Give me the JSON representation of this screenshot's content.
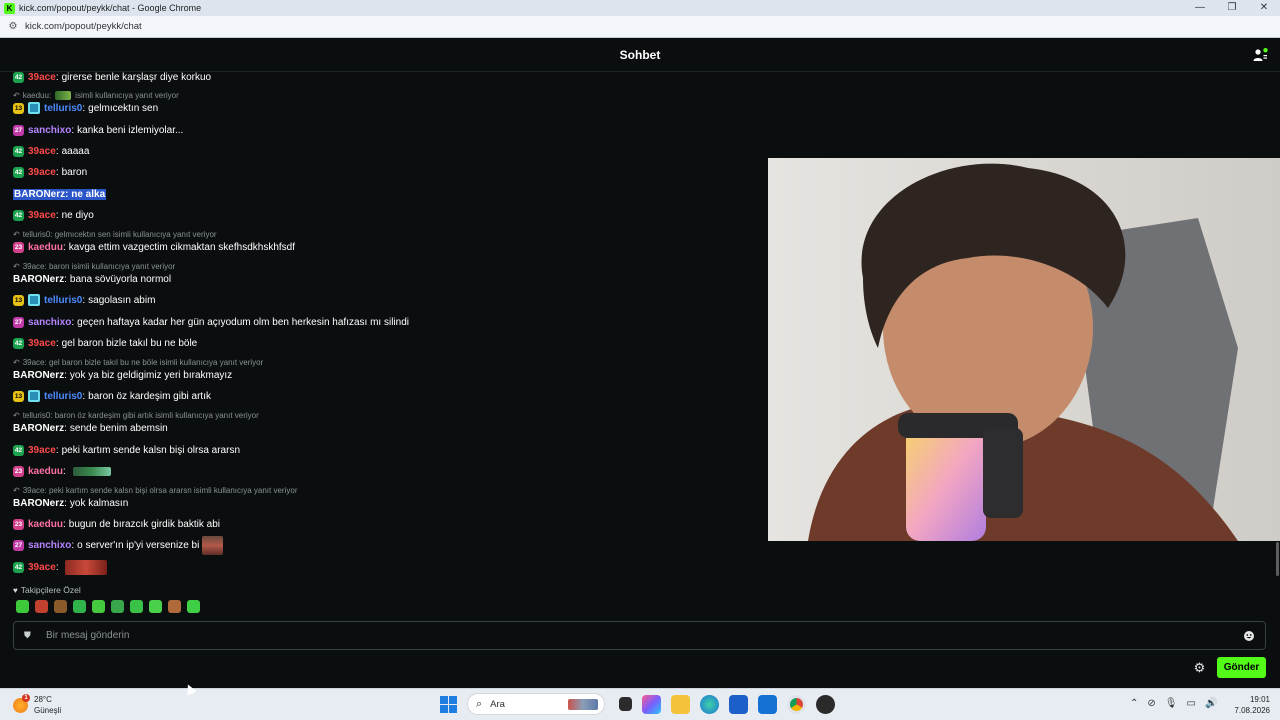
{
  "window": {
    "title": "kick.com/popout/peykk/chat - Google Chrome",
    "logo_letter": "K",
    "controls": [
      "—",
      "❐",
      "✕"
    ]
  },
  "address": {
    "url": "kick.com/popout/peykk/chat"
  },
  "chat_header": {
    "title": "Sohbet"
  },
  "chat": {
    "m1": {
      "user": "39ace",
      "text": "girerse benle karşlaşr diye korkuo",
      "level": "42"
    },
    "r1": {
      "user": "kaeduu:",
      "text": "isimli kullanıcıya yanıt veriyor"
    },
    "m2": {
      "user": "telluris0",
      "text": "gelmıcektın sen",
      "level": "13"
    },
    "m3": {
      "user": "sanchixo",
      "text": "kanka beni izlemiyolar...",
      "level": "27"
    },
    "m4": {
      "user": "39ace",
      "text": "aaaaa",
      "level": "42"
    },
    "m5": {
      "user": "39ace",
      "text": "baron",
      "level": "42"
    },
    "m6": {
      "full": "BARONerz: ne alka"
    },
    "m7": {
      "user": "39ace",
      "text": "ne diyo",
      "level": "42"
    },
    "r2": {
      "text": "telluris0: gelmıcektın sen isimli kullanıcıya yanıt veriyor"
    },
    "m8": {
      "user": "kaeduu",
      "text": "kavga ettim vazgectim cikmaktan skefhsdkhskhfsdf",
      "level": "23"
    },
    "r3": {
      "text": "39ace: baron isimli kullanıcıya yanıt veriyor"
    },
    "m9": {
      "user": "BARONerz",
      "text": "bana sövüyorla normol"
    },
    "m10": {
      "user": "telluris0",
      "text": "sagolasın abim",
      "level": "13"
    },
    "m11": {
      "user": "sanchixo",
      "text": "geçen haftaya kadar her gün açıyodum olm ben herkesin hafızası mı silindi",
      "level": "27"
    },
    "m12": {
      "user": "39ace",
      "text": "gel baron bizle takıl bu ne böle",
      "level": "42"
    },
    "r4": {
      "text": "39ace: gel baron bizle takıl bu ne böle isimli kullanıcıya yanıt veriyor"
    },
    "m13": {
      "user": "BARONerz",
      "text": "yok ya biz geldigimiz yeri bırakmayız"
    },
    "m14": {
      "user": "telluris0",
      "text": "baron öz kardeşim gibi artık",
      "level": "13"
    },
    "r5": {
      "text": "telluris0: baron öz kardeşim gibi artık isimli kullanıcıya yanıt veriyor"
    },
    "m15": {
      "user": "BARONerz",
      "text": "sende benim abemsin"
    },
    "m16": {
      "user": "39ace",
      "text": "peki kartım sende kalsn bişi olrsa ararsn",
      "level": "42"
    },
    "m17": {
      "user": "kaeduu",
      "text": "",
      "level": "23"
    },
    "r6": {
      "text": "39ace: peki kartım sende kalsn bişi olrsa ararsn isimli kullanıcıya yanıt veriyor"
    },
    "m18": {
      "user": "BARONerz",
      "text": "yok kalmasın"
    },
    "m19": {
      "user": "kaeduu",
      "text": "bugun de bırazcık girdik baktik abi",
      "level": "23"
    },
    "m20": {
      "user": "sanchixo",
      "text": "o server'ın ip'yi versenize bi",
      "level": "27"
    },
    "m21": {
      "user": "39ace",
      "text": "",
      "level": "42"
    },
    "separator": ":"
  },
  "followers_only": {
    "label": "Takipçilere Özel"
  },
  "emote_bar": {
    "colors": [
      "#3ec93a",
      "#c2402f",
      "#8a5a2a",
      "#2fb34a",
      "#45c93f",
      "#3aa64b",
      "#39c247",
      "#4ad14b",
      "#b06a3a",
      "#3fcf47"
    ]
  },
  "input": {
    "placeholder": "Bir mesaj gönderin"
  },
  "send_button": {
    "label": "Gönder"
  },
  "colors": {
    "accent": "#53fc18",
    "background": "#0b0e0f"
  },
  "taskbar": {
    "weather_temp": "28°C",
    "weather_desc": "Güneşli",
    "weather_badge": "1",
    "search_label": "Ara",
    "time": "19:01",
    "date": "7.08.2026"
  }
}
